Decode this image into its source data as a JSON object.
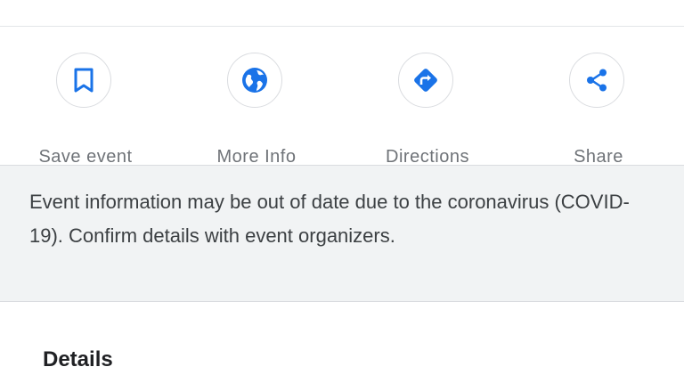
{
  "actions": [
    {
      "label": "Save event",
      "icon": "bookmark-icon"
    },
    {
      "label": "More Info",
      "icon": "globe-icon"
    },
    {
      "label": "Directions",
      "icon": "directions-icon"
    },
    {
      "label": "Share",
      "icon": "share-icon"
    }
  ],
  "notice": {
    "text": "Event information may be out of date due to the coronavirus (COVID-19). Confirm details with event organizers."
  },
  "details": {
    "title": "Details"
  },
  "colors": {
    "accent": "#1a73e8",
    "label_gray": "#6f7378",
    "notice_bg": "#f1f3f4",
    "divider": "#dadce0"
  }
}
